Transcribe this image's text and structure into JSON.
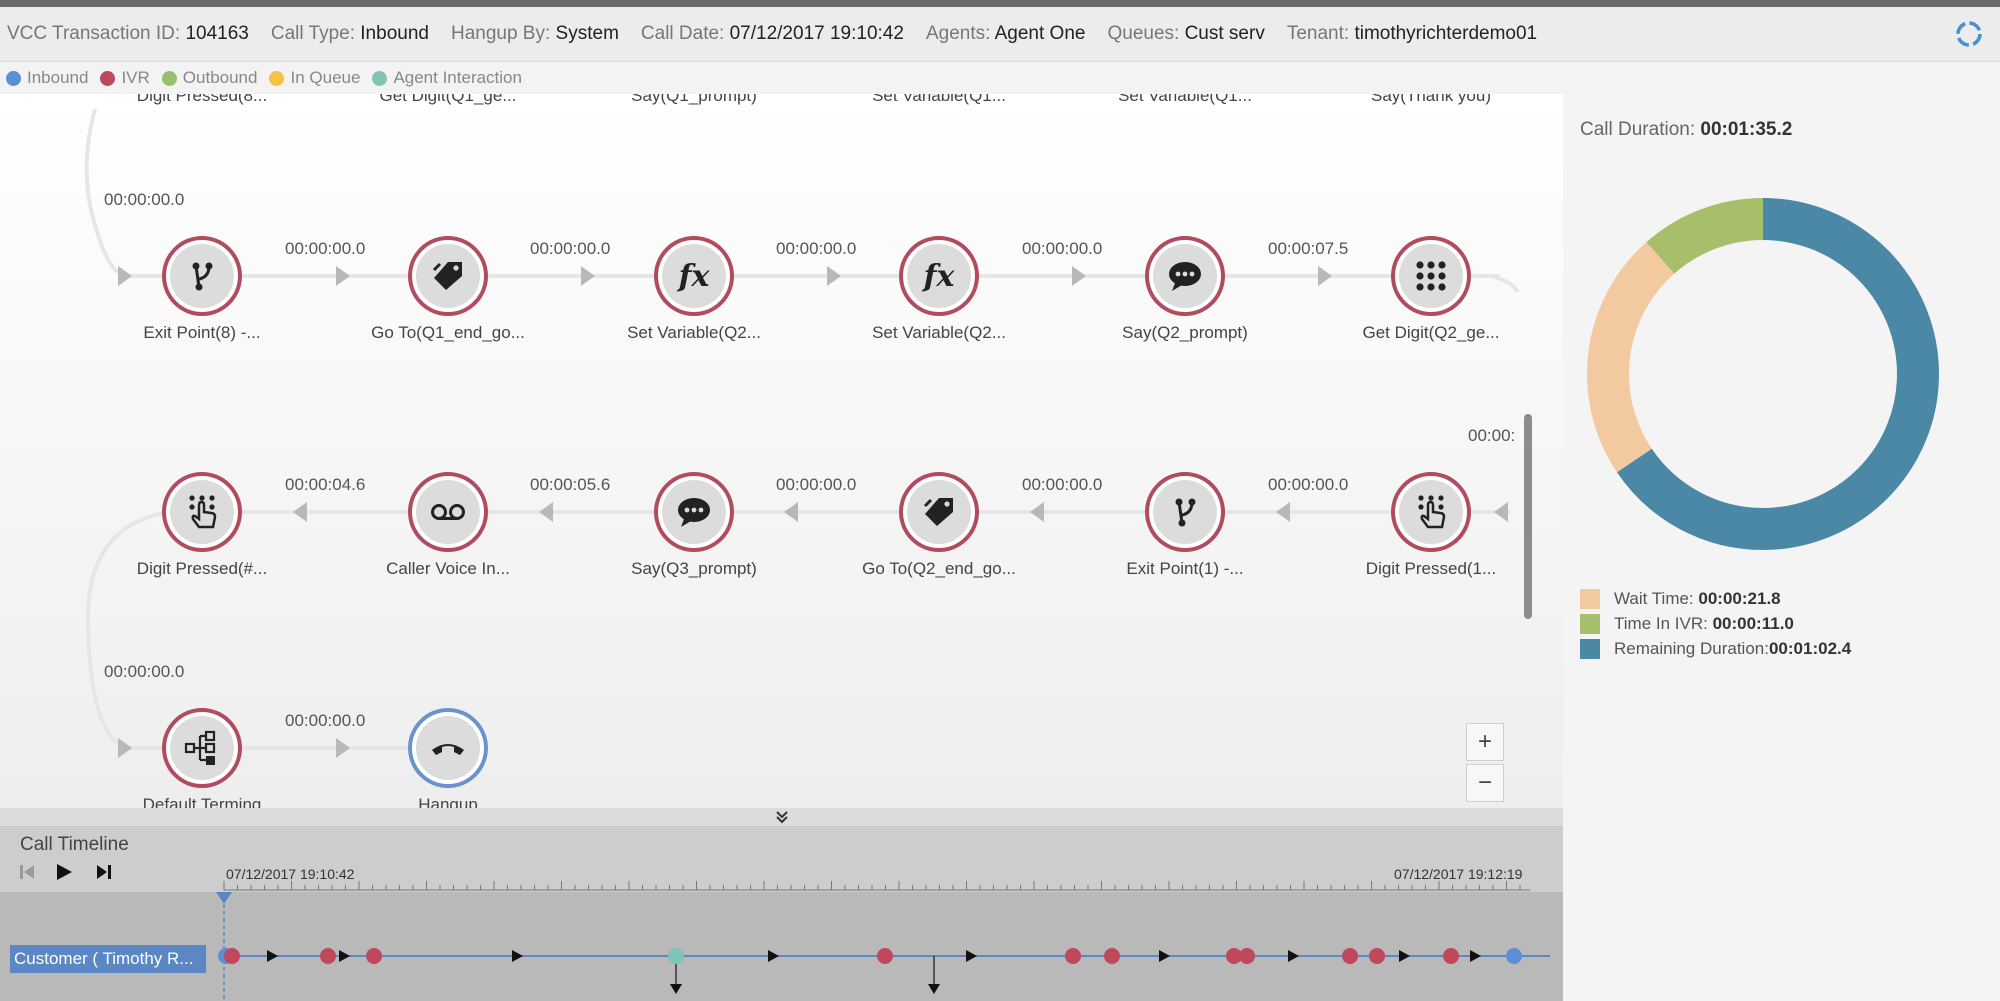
{
  "header": {
    "items": [
      {
        "label": "VCC Transaction ID:",
        "value": "104163"
      },
      {
        "label": "Call Type:",
        "value": "Inbound"
      },
      {
        "label": "Hangup By:",
        "value": "System"
      },
      {
        "label": "Call Date:",
        "value": "07/12/2017 19:10:42"
      },
      {
        "label": "Agents:",
        "value": "Agent One"
      },
      {
        "label": "Queues:",
        "value": "Cust serv"
      },
      {
        "label": "Tenant:",
        "value": "timothyrichterdemo01"
      }
    ],
    "refresh_icon": "refresh-icon"
  },
  "legend": [
    {
      "label": "Inbound",
      "color": "#5b8fd6"
    },
    {
      "label": "IVR",
      "color": "#c0485b"
    },
    {
      "label": "Outbound",
      "color": "#97c06a"
    },
    {
      "label": "In Queue",
      "color": "#f2c244"
    },
    {
      "label": "Agent Interaction",
      "color": "#7fc4b4"
    }
  ],
  "flow": {
    "top_partial": [
      "Digit Pressed(8...",
      "Get Digit(Q1_ge...",
      "Say(Q1_prompt)",
      "Set Variable(Q1...",
      "Set Variable(Q1...",
      "Say(Thank you)"
    ],
    "row1_entry_duration": "00:00:00.0",
    "row1": [
      {
        "label": "Exit Point(8) -...",
        "icon": "branch-icon"
      },
      {
        "label": "Go To(Q1_end_go...",
        "icon": "tag-icon"
      },
      {
        "label": "Set Variable(Q2...",
        "icon": "fx-icon"
      },
      {
        "label": "Set Variable(Q2...",
        "icon": "fx-icon"
      },
      {
        "label": "Say(Q2_prompt)",
        "icon": "speech-bubble-icon"
      },
      {
        "label": "Get Digit(Q2_ge...",
        "icon": "keypad-icon"
      }
    ],
    "row1_durations": [
      "00:00:00.0",
      "00:00:00.0",
      "00:00:00.0",
      "00:00:00.0",
      "00:00:07.5"
    ],
    "row2_edge_duration": "00:00:",
    "row2": [
      {
        "label": "Digit Pressed(#...",
        "icon": "hand-press-icon"
      },
      {
        "label": "Caller Voice In...",
        "icon": "voicemail-icon"
      },
      {
        "label": "Say(Q3_prompt)",
        "icon": "speech-bubble-icon"
      },
      {
        "label": "Go To(Q2_end_go...",
        "icon": "tag-icon"
      },
      {
        "label": "Exit Point(1) -...",
        "icon": "branch-icon"
      },
      {
        "label": "Digit Pressed(1...",
        "icon": "hand-press-icon"
      }
    ],
    "row2_durations": [
      "00:00:04.6",
      "00:00:05.6",
      "00:00:00.0",
      "00:00:00.0",
      "00:00:00.0"
    ],
    "row3_entry_duration": "00:00:00.0",
    "row3": [
      {
        "label": "Default Terming",
        "icon": "org-chart-icon"
      },
      {
        "label": "Hangup",
        "icon": "phone-hangup-icon"
      }
    ],
    "row3_durations": [
      "00:00:00.0"
    ],
    "zoom_in": "+",
    "zoom_out": "−"
  },
  "timeline": {
    "title": "Call Timeline",
    "start": "07/12/2017 19:10:42",
    "end": "07/12/2017 19:12:19",
    "customer": "Customer ( Timothy R...",
    "controls": [
      "skip-back-icon",
      "play-icon",
      "skip-forward-icon"
    ]
  },
  "duration": {
    "label": "Call Duration:",
    "value": "00:01:35.2",
    "items": [
      {
        "label": "Wait Time:",
        "value": "00:00:21.8",
        "color": "#f3c9a0"
      },
      {
        "label": "Time In IVR:",
        "value": "00:00:11.0",
        "color": "#a7be6b"
      },
      {
        "label": "Remaining Duration:",
        "value": "00:01:02.4",
        "color": "#4a88a6"
      }
    ]
  }
}
